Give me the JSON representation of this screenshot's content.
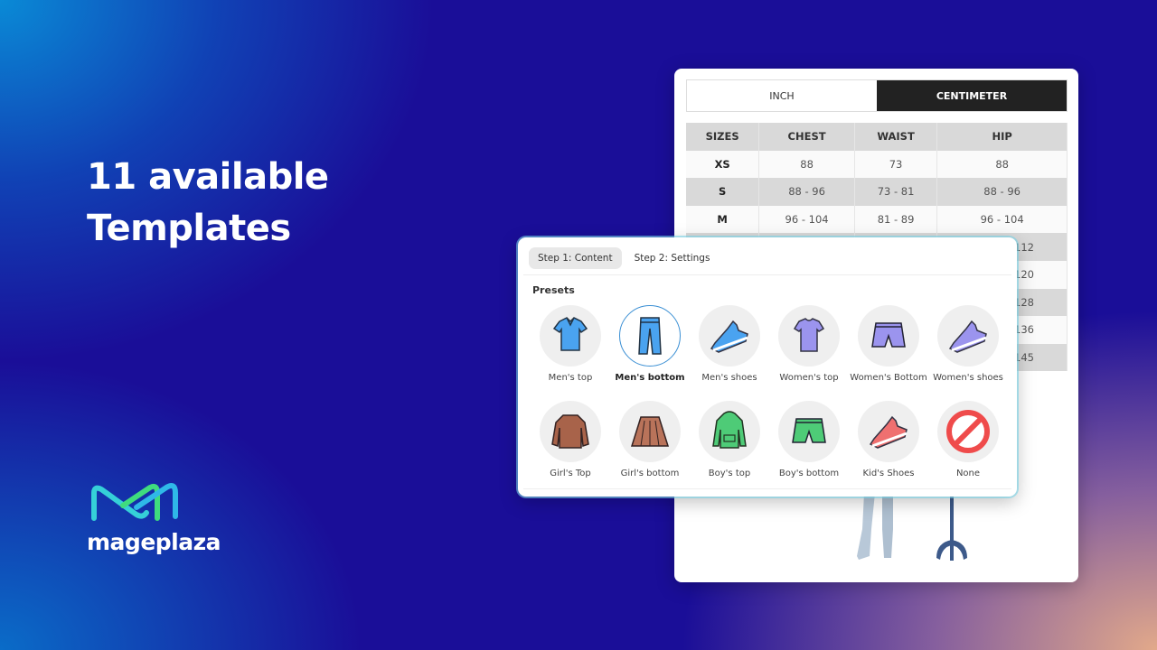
{
  "headline": {
    "line1": "11 available",
    "line2": "Templates"
  },
  "brand": {
    "name": "mageplaza",
    "colors": [
      "#35d6d0",
      "#3fdc7e"
    ]
  },
  "unit_tabs": [
    {
      "label": "INCH",
      "active": false
    },
    {
      "label": "CENTIMETER",
      "active": true
    }
  ],
  "size_table": {
    "headers": [
      "SIZES",
      "CHEST",
      "WAIST",
      "HIP"
    ],
    "rows": [
      [
        "XS",
        "88",
        "73",
        "88"
      ],
      [
        "S",
        "88 - 96",
        "73 - 81",
        "88 - 96"
      ],
      [
        "M",
        "96 - 104",
        "81 - 89",
        "96 - 104"
      ]
    ],
    "partial_hip": [
      "- 112",
      "- 120",
      "- 128",
      "- 136",
      "- 145"
    ]
  },
  "popup": {
    "steps": [
      {
        "label": "Step 1: Content",
        "active": true
      },
      {
        "label": "Step 2: Settings",
        "active": false
      }
    ],
    "presets_title": "Presets",
    "presets": [
      {
        "label": "Men's top",
        "icon": "shirt",
        "color": "#4aa3f0",
        "selected": false
      },
      {
        "label": "Men's bottom",
        "icon": "pants",
        "color": "#4aa3f0",
        "selected": true
      },
      {
        "label": "Men's shoes",
        "icon": "shoe",
        "color": "#4aa3f0",
        "selected": false
      },
      {
        "label": "Women's top",
        "icon": "tshirt",
        "color": "#9b94ee",
        "selected": false
      },
      {
        "label": "Women's Bottom",
        "icon": "shorts",
        "color": "#9b94ee",
        "selected": false
      },
      {
        "label": "Women's shoes",
        "icon": "shoe",
        "color": "#9b94ee",
        "selected": false
      },
      {
        "label": "Girl's Top",
        "icon": "sweater",
        "color": "#a8634a",
        "selected": false
      },
      {
        "label": "Girl's bottom",
        "icon": "skirt",
        "color": "#b9735a",
        "selected": false
      },
      {
        "label": "Boy's top",
        "icon": "hoodie",
        "color": "#4ecb77",
        "selected": false
      },
      {
        "label": "Boy's bottom",
        "icon": "shorts",
        "color": "#4ecb77",
        "selected": false
      },
      {
        "label": "Kid's Shoes",
        "icon": "shoe",
        "color": "#ef7070",
        "selected": false
      },
      {
        "label": "None",
        "icon": "no-sign",
        "color": "#ef4b4b",
        "selected": false
      }
    ]
  }
}
